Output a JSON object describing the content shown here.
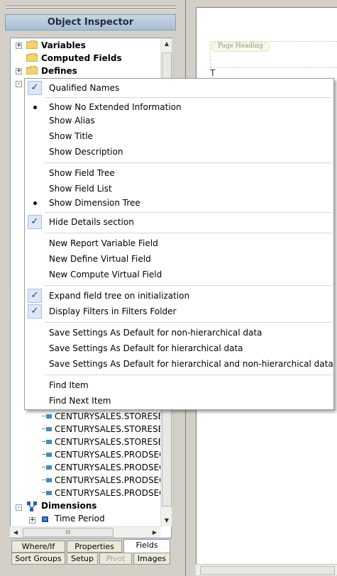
{
  "inspector": {
    "title": "Object Inspector",
    "tree_items": {
      "variables": "Variables",
      "computed_fields": "Computed Fields",
      "defines": "Defines",
      "fields": [
        "CENTURYSALES.STORESEG.T",
        "CENTURYSALES.STORESEG.T",
        "CENTURYSALES.STORESEG.E",
        "CENTURYSALES.PRODSEG.P",
        "CENTURYSALES.PRODSEG.Q",
        "CENTURYSALES.PRODSEG.P",
        "CENTURYSALES.PRODSEG.C"
      ],
      "dimensions": "Dimensions",
      "time_period": "Time Period"
    },
    "tabs_row1": [
      "Where/If",
      "Properties",
      "Fields"
    ],
    "tabs_row2": [
      "Sort Groups",
      "Setup",
      "Pivot",
      "Images"
    ],
    "active_tab": "Fields",
    "disabled_tab": "Pivot",
    "hscroll_grip": "III"
  },
  "canvas": {
    "page_heading_label": "Page Heading",
    "cursor_glyph": "T"
  },
  "context_menu": {
    "qualified_names": "Qualified Names",
    "show_no_extended": "Show No Extended Information",
    "show_alias": "Show Alias",
    "show_title": "Show Title",
    "show_description": "Show Description",
    "show_field_tree": "Show Field Tree",
    "show_field_list": "Show Field List",
    "show_dimension_tree": "Show Dimension Tree",
    "hide_details": "Hide Details section",
    "new_report_variable": "New Report Variable Field",
    "new_define_virtual": "New Define Virtual Field",
    "new_compute_virtual": "New Compute Virtual Field",
    "expand_field_tree": "Expand field tree on initialization",
    "display_filters": "Display Filters in Filters Folder",
    "save_nonhier": "Save Settings As Default for non-hierarchical data",
    "save_hier": "Save Settings As Default for hierarchical data",
    "save_both": "Save Settings As Default for hierarchical and non-hierarchical data",
    "find_item": "Find Item",
    "find_next": "Find Next Item"
  },
  "colors": {
    "check_bg": "#dce8f6",
    "title_bg": "#b6c8dc"
  }
}
